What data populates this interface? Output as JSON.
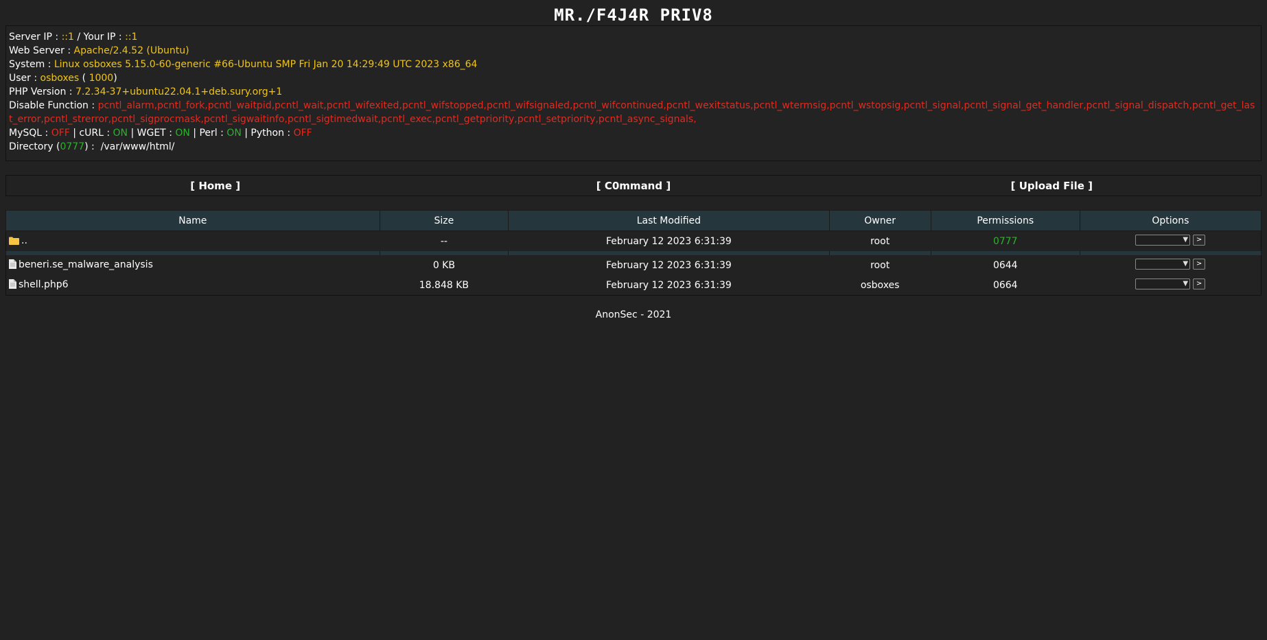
{
  "header": {
    "title": "MR./F4J4R PRIV8"
  },
  "info": {
    "server_ip_label": "Server IP : ",
    "server_ip": "::1",
    "your_ip_label": " / Your IP : ",
    "your_ip": "::1",
    "webserver_label": "Web Server : ",
    "webserver": "Apache/2.4.52 (Ubuntu)",
    "system_label": "System : ",
    "system": "Linux osboxes 5.15.0-60-generic #66-Ubuntu SMP Fri Jan 20 14:29:49 UTC 2023 x86_64",
    "user_label": "User : ",
    "user": "osboxes",
    "uid_open": " ( ",
    "uid": "1000",
    "uid_close": ")",
    "php_label": "PHP Version : ",
    "php": "7.2.34-37+ubuntu22.04.1+deb.sury.org+1",
    "disable_label": "Disable Function : ",
    "disable": "pcntl_alarm,pcntl_fork,pcntl_waitpid,pcntl_wait,pcntl_wifexited,pcntl_wifstopped,pcntl_wifsignaled,pcntl_wifcontinued,pcntl_wexitstatus,pcntl_wtermsig,pcntl_wstopsig,pcntl_signal,pcntl_signal_get_handler,pcntl_signal_dispatch,pcntl_get_last_error,pcntl_strerror,pcntl_sigprocmask,pcntl_sigwaitinfo,pcntl_sigtimedwait,pcntl_exec,pcntl_getpriority,pcntl_setpriority,pcntl_async_signals,",
    "mysql_label": "MySQL : ",
    "mysql": "OFF",
    "curl_label": " | cURL : ",
    "curl": "ON",
    "wget_label": " | WGET : ",
    "wget": "ON",
    "perl_label": " | Perl : ",
    "perl": "ON",
    "python_label": " | Python : ",
    "python": "OFF",
    "dir_label": "Directory (",
    "dir_perm": "0777",
    "dir_sep": ") :  ",
    "dir_path": "/var/www/html/"
  },
  "nav": {
    "home": "[ Home ]",
    "command": "[ C0mmand ]",
    "upload": "[ Upload File ]"
  },
  "table": {
    "headers": [
      "Name",
      "Size",
      "Last Modified",
      "Owner",
      "Permissions",
      "Options"
    ],
    "parent": {
      "name": "..",
      "size": "--",
      "modified": "February 12 2023 6:31:39",
      "owner": "root",
      "perm": "0777"
    },
    "files": [
      {
        "name": "beneri.se_malware_analysis",
        "size": "0 KB",
        "modified": "February 12 2023 6:31:39",
        "owner": "root",
        "perm": "0644"
      },
      {
        "name": "shell.php6",
        "size": "18.848 KB",
        "modified": "February 12 2023 6:31:39",
        "owner": "osboxes",
        "perm": "0664"
      }
    ],
    "go_label": ">"
  },
  "footer": {
    "text": "AnonSec - 2021"
  },
  "colors": {
    "accent_yellow": "#f0c419",
    "off_red": "#e02b20",
    "on_green": "#2bb32b",
    "header_bg": "#25363d"
  }
}
